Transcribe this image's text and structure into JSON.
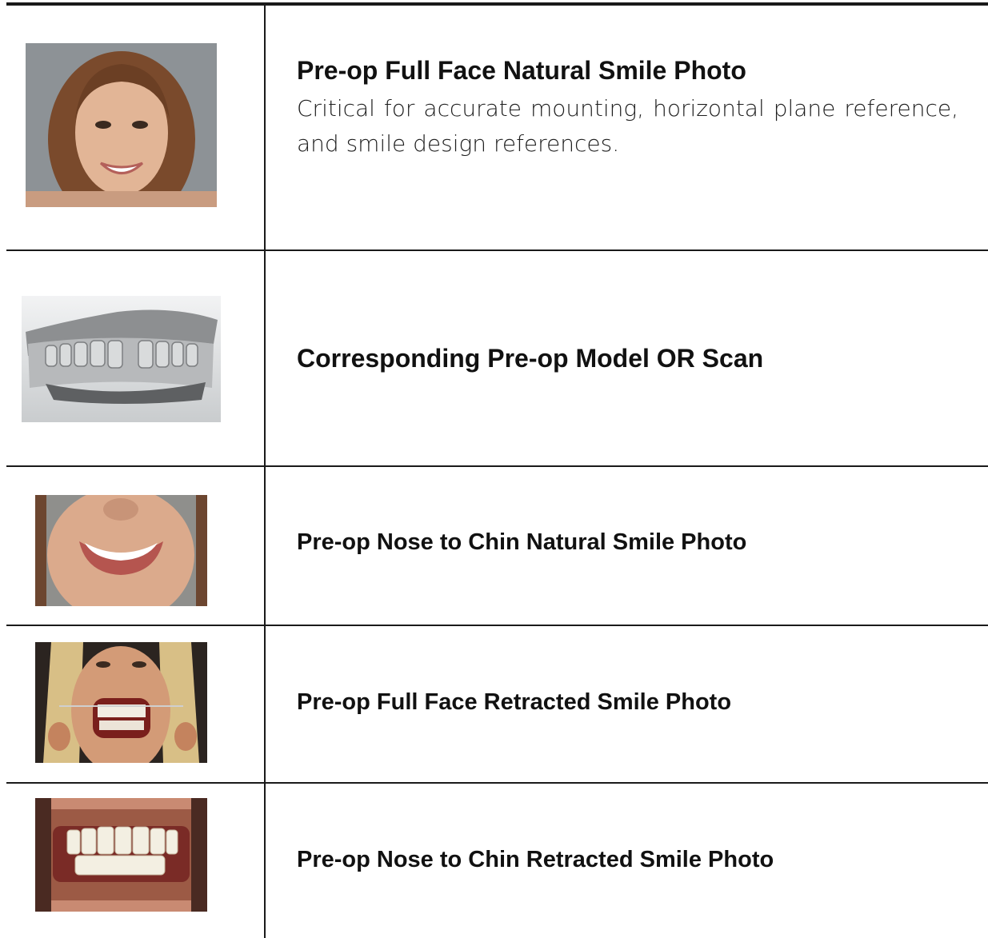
{
  "rows": [
    {
      "title": "Pre-op Full Face Natural Smile Photo",
      "description": "Critical for accurate mounting, horizontal plane reference, and smile design references.",
      "image": "full-face-natural-smile-photo"
    },
    {
      "title": "Corresponding Pre-op Model OR Scan",
      "image": "dental-model-scan"
    },
    {
      "title": "Pre-op Nose to Chin Natural Smile Photo",
      "image": "nose-to-chin-natural-smile-photo"
    },
    {
      "title": "Pre-op Full Face Retracted Smile Photo",
      "image": "full-face-retracted-smile-photo"
    },
    {
      "title": "Pre-op Nose to Chin Retracted Smile Photo",
      "image": "nose-to-chin-retracted-smile-photo"
    }
  ],
  "colors": {
    "rule": "#1a1a1a",
    "text": "#111111"
  }
}
